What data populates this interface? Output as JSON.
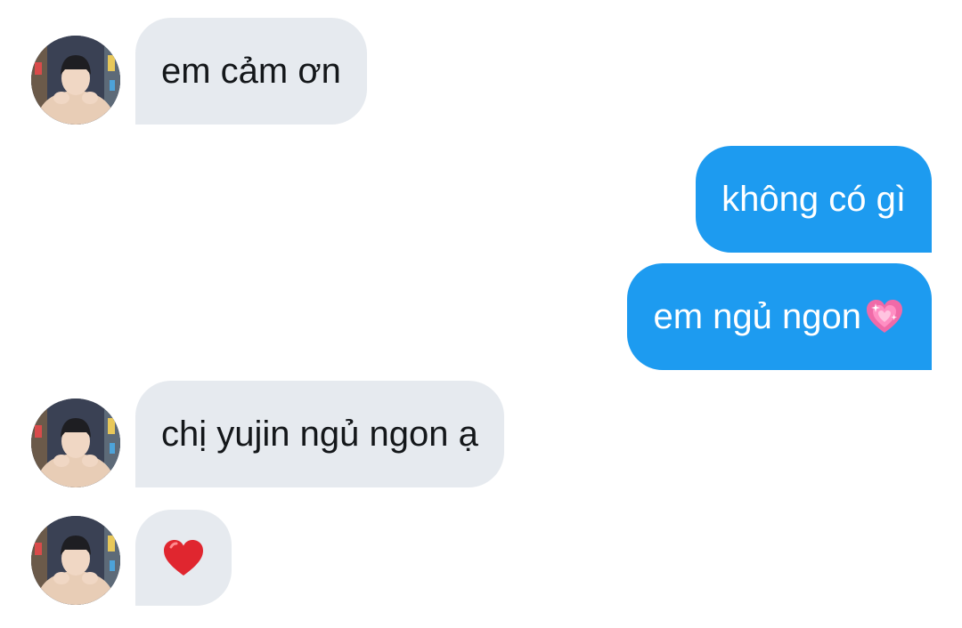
{
  "contact": {
    "avatar_icon": "profile-photo-avatar"
  },
  "messages": [
    {
      "direction": "incoming",
      "text": "em cảm ơn"
    },
    {
      "direction": "outgoing",
      "text": "không có gì"
    },
    {
      "direction": "outgoing",
      "text": "em ngủ ngon",
      "emoji": "sparkling-heart-icon"
    },
    {
      "direction": "incoming",
      "text": "chị yujin ngủ ngon ạ"
    },
    {
      "direction": "incoming",
      "emoji": "red-heart-icon"
    }
  ],
  "colors": {
    "incoming_bubble": "#e6eaef",
    "outgoing_bubble": "#1d9bf0",
    "incoming_text": "#14171a",
    "outgoing_text": "#ffffff"
  }
}
